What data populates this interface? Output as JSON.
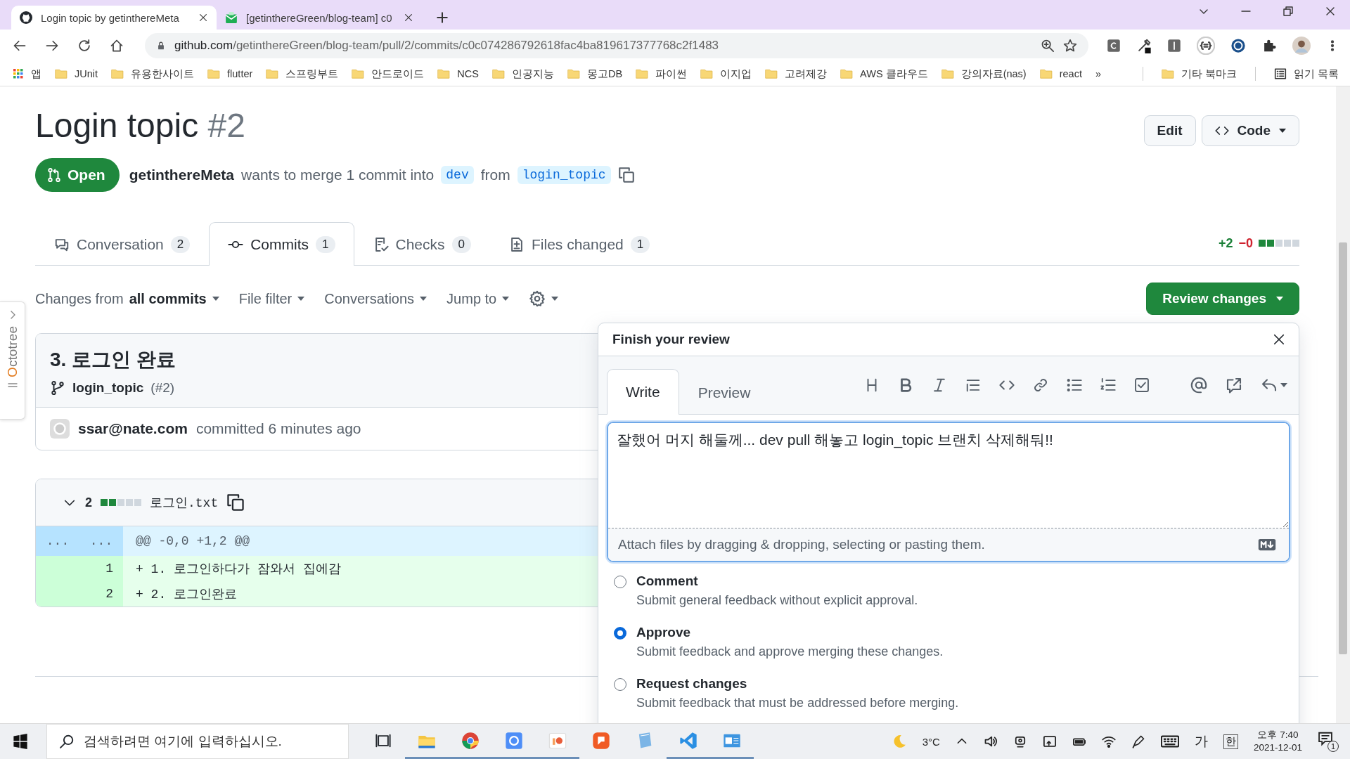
{
  "browser": {
    "tabs": [
      {
        "title": "Login topic by getinthereMeta",
        "selected": true
      },
      {
        "title": "[getinthereGreen/blog-team] c0",
        "selected": false
      }
    ],
    "url": {
      "host": "github.com",
      "path": "/getinthereGreen/blog-team/pull/2/commits/c0c074286792618fac4ba819617377768c2f1483"
    },
    "bookmarks": [
      {
        "label": "앱",
        "kind": "apps"
      },
      {
        "label": "JUnit",
        "kind": "folder"
      },
      {
        "label": "유용한사이트",
        "kind": "folder"
      },
      {
        "label": "flutter",
        "kind": "folder"
      },
      {
        "label": "스프링부트",
        "kind": "folder"
      },
      {
        "label": "안드로이드",
        "kind": "folder"
      },
      {
        "label": "NCS",
        "kind": "folder"
      },
      {
        "label": "인공지능",
        "kind": "folder"
      },
      {
        "label": "몽고DB",
        "kind": "folder"
      },
      {
        "label": "파이썬",
        "kind": "folder"
      },
      {
        "label": "이지업",
        "kind": "folder"
      },
      {
        "label": "고려제강",
        "kind": "folder"
      },
      {
        "label": "AWS 클라우드",
        "kind": "folder"
      },
      {
        "label": "강의자료(nas)",
        "kind": "folder"
      },
      {
        "label": "react",
        "kind": "folder"
      }
    ],
    "overflow": "»",
    "other_bookmarks": "기타 북마크",
    "reading_list": "읽기 목록"
  },
  "pull_request": {
    "title": "Login topic",
    "number": "#2",
    "state": "Open",
    "author": "getinthereMeta",
    "summary": "wants to merge 1 commit into",
    "base": "dev",
    "from": "from",
    "head": "login_topic",
    "buttons": [
      "Edit",
      "Code"
    ]
  },
  "pr_tabs": [
    {
      "label": "Conversation",
      "count": "2",
      "selected": false
    },
    {
      "label": "Commits",
      "count": "1",
      "selected": true
    },
    {
      "label": "Checks",
      "count": "0",
      "selected": false
    },
    {
      "label": "Files changed",
      "count": "1",
      "selected": false
    }
  ],
  "diffstat": {
    "added": "+2",
    "removed": "−0"
  },
  "toolbar": {
    "changes_prefix": "Changes from",
    "changes_value": "all commits",
    "items": [
      "File filter",
      "Conversations",
      "Jump to"
    ],
    "review_button": "Review changes"
  },
  "commit": {
    "title": "3. 로그인 완료",
    "branch": "login_topic",
    "pr": "(#2)",
    "author": "ssar@nate.com",
    "when": "committed 6 minutes ago"
  },
  "file": {
    "changes": "2",
    "name": "로그인.txt",
    "hunk": {
      "old": "...",
      "new": "...",
      "text": "@@ -0,0 +1,2 @@"
    },
    "lines": [
      {
        "number": "1",
        "text": "+ 1. 로그인하다가 잠와서 집에감"
      },
      {
        "number": "2",
        "text": "+ 2. 로그인완료"
      }
    ]
  },
  "review": {
    "title": "Finish your review",
    "tabs": [
      {
        "label": "Write",
        "selected": true
      },
      {
        "label": "Preview",
        "selected": false
      }
    ],
    "body": "잘했어 머지 해둘께... dev pull 해놓고 login_topic 브랜치 삭제해둬!!",
    "attach_hint": "Attach files by dragging & dropping, selecting or pasting them.",
    "options": [
      {
        "label": "Comment",
        "description": "Submit general feedback without explicit approval.",
        "selected": false
      },
      {
        "label": "Approve",
        "description": "Submit feedback and approve merging these changes.",
        "selected": true
      },
      {
        "label": "Request changes",
        "description": "Submit feedback that must be addressed before merging.",
        "selected": false
      }
    ]
  },
  "octotree": {
    "label": "Octotree"
  },
  "taskbar": {
    "search": {
      "placeholder": "검색하려면 여기에 입력하십시오."
    },
    "apps": [
      {
        "kind": "explorer",
        "running": true
      },
      {
        "kind": "chrome",
        "running": true
      },
      {
        "kind": "settings",
        "running": true
      },
      {
        "kind": "slides",
        "running": true
      },
      {
        "kind": "notes",
        "running": false
      },
      {
        "kind": "notepad",
        "running": false
      },
      {
        "kind": "code",
        "running": true
      },
      {
        "kind": "window",
        "running": true
      }
    ],
    "weather": "3°C",
    "ime": "가",
    "ime_mode": "한",
    "time": "오후 7:40",
    "date": "2021-12-01",
    "notifications": "1"
  }
}
